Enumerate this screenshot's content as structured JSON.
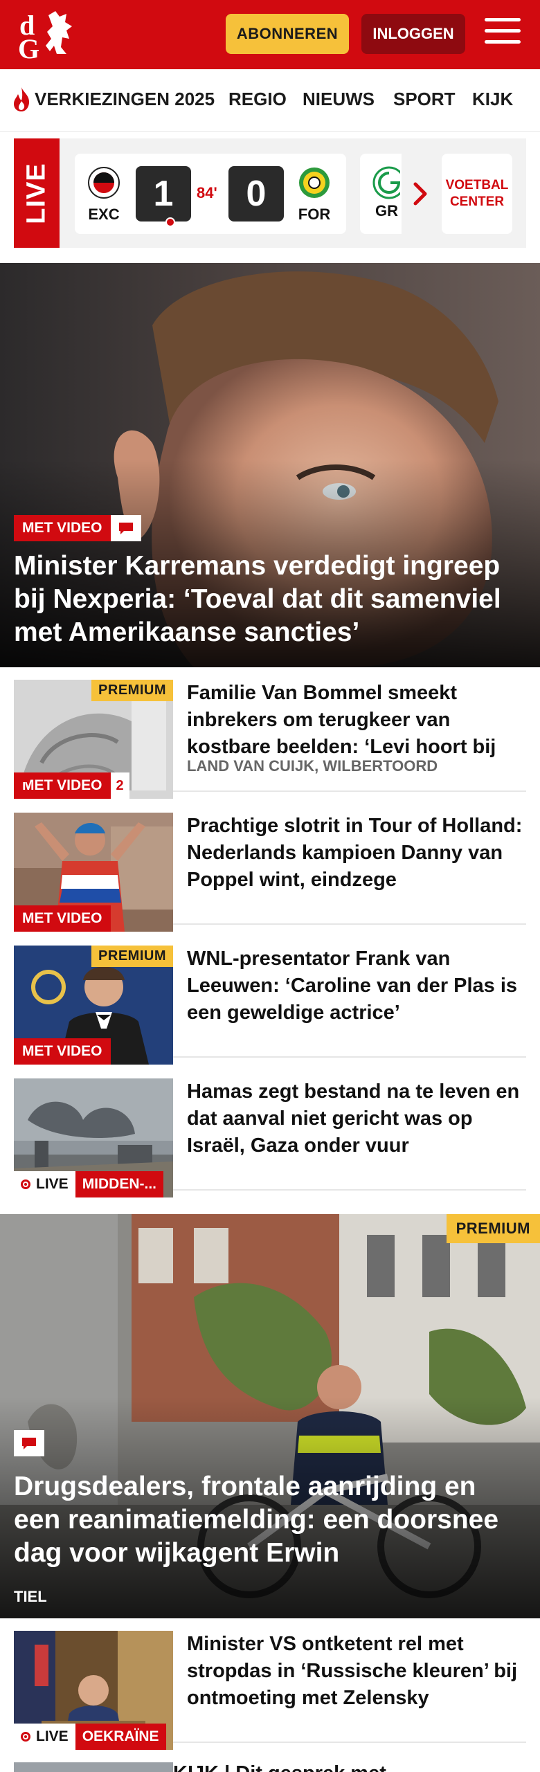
{
  "header": {
    "logo_icon": "dg-logo-icon",
    "subscribe_label": "ABONNEREN",
    "login_label": "INLOGGEN",
    "menu_icon": "hamburger-icon",
    "brand_color": "#d10a10",
    "accent_color": "#f6c13a"
  },
  "nav": {
    "items": [
      {
        "label": "VERKIEZINGEN 2025",
        "icon": "flame-icon"
      },
      {
        "label": "REGIO"
      },
      {
        "label": "NIEUWS"
      },
      {
        "label": "SPORT"
      },
      {
        "label": "KIJK"
      }
    ]
  },
  "live_scores": {
    "tag": "LIVE",
    "match": {
      "home_code": "EXC",
      "home_score": "1",
      "minute": "84'",
      "away_score": "0",
      "away_code": "FOR"
    },
    "next_code": "GR",
    "next_icon": "chevron-right-icon",
    "center_label": "VOETBAL CENTER"
  },
  "hero": {
    "badge": "MET VIDEO",
    "comment_icon": "comment-icon",
    "title": "Minister Karremans verdedigt ingreep bij Nexperia: ‘Toeval dat dit samenviel met Amerikaanse sancties’"
  },
  "articles": [
    {
      "premium": "PREMIUM",
      "badge": "MET VIDEO",
      "comments": "2",
      "title": "Familie Van Bommel smeekt inbrekers om terugkeer van kostbare beelden: ‘Levi hoort bij ons’",
      "location": "LAND VAN CUIJK, WILBERTOORD"
    },
    {
      "badge": "MET VIDEO",
      "title": "Prachtige slotrit in Tour of Holland: Nederlands kampioen Danny van Poppel wint, eindzege"
    },
    {
      "premium": "PREMIUM",
      "badge": "MET VIDEO",
      "title": "WNL-presentator Frank van Leeuwen: ‘Caroline van der Plas is een geweldige actrice’"
    },
    {
      "live": "LIVE",
      "topic": "MIDDEN-...",
      "title": "Hamas zegt bestand na te leven en dat aanval niet gericht was op Israël, Gaza onder vuur"
    }
  ],
  "feature": {
    "premium": "PREMIUM",
    "comment_icon": "comment-icon",
    "title": "Drugsdealers, frontale aanrijding en een reanimatiemelding: een doorsnee dag voor wijkagent Erwin",
    "location": "TIEL"
  },
  "article_after": {
    "live": "LIVE",
    "topic": "OEKRAÏNE",
    "title": "Minister VS ontketent rel met stropdas in ‘Russische kleuren’ bij ontmoeting met Zelensky"
  },
  "article_cut": {
    "title": "KIJK | Dit gesprek met"
  }
}
